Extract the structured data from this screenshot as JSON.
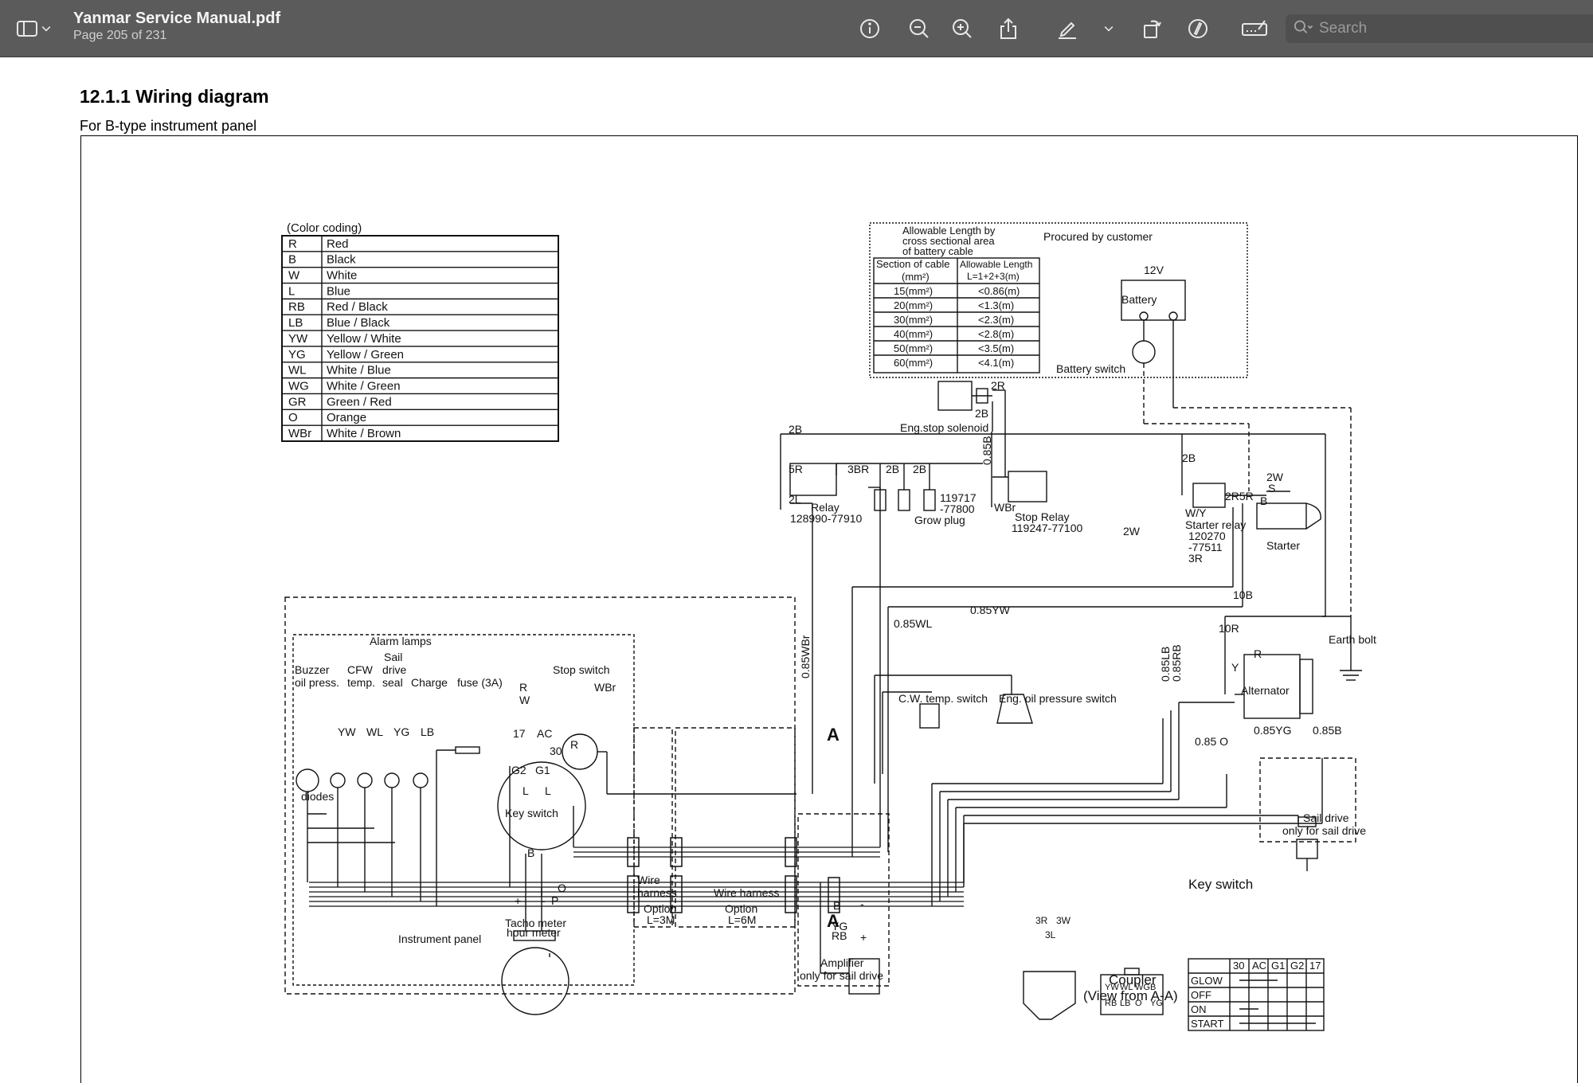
{
  "app": {
    "title": "Yanmar Service Manual.pdf",
    "subtitle": "Page 205 of 231",
    "search_placeholder": "Search",
    "icons": [
      "sidebar-icon",
      "chevron-down-icon",
      "info-icon",
      "zoom-out-icon",
      "zoom-in-icon",
      "share-icon",
      "highlight-pen-icon",
      "chevron-down-icon",
      "rotate-icon",
      "markup-icon",
      "form-fill-icon",
      "search-icon"
    ]
  },
  "page": {
    "section_title": "12.1.1 Wiring diagram",
    "section_subtitle": "For B-type instrument panel"
  },
  "diagram": {
    "color_coding": {
      "title": "(Color coding)",
      "rows": [
        [
          "R",
          "Red"
        ],
        [
          "B",
          "Black"
        ],
        [
          "W",
          "White"
        ],
        [
          "L",
          "Blue"
        ],
        [
          "RB",
          "Red / Black"
        ],
        [
          "LB",
          "Blue / Black"
        ],
        [
          "YW",
          "Yellow / White"
        ],
        [
          "YG",
          "Yellow / Green"
        ],
        [
          "WL",
          "White / Blue"
        ],
        [
          "WG",
          "White / Green"
        ],
        [
          "GR",
          "Green / Red"
        ],
        [
          "O",
          "Orange"
        ],
        [
          "WBr",
          "White / Brown"
        ]
      ]
    },
    "cable_table": {
      "title_lines": [
        "Allowable Length by",
        "cross sectional area",
        "of battery cable"
      ],
      "procured": "Procured by customer",
      "head1": [
        "Section of cable",
        "(mm²)"
      ],
      "head2": [
        "Allowable Length",
        "L=1+2+3(m)"
      ],
      "rows": [
        [
          "15(mm²)",
          "<0.86(m)"
        ],
        [
          "20(mm²)",
          "<1.3(m)"
        ],
        [
          "30(mm²)",
          "<2.3(m)"
        ],
        [
          "40(mm²)",
          "<2.8(m)"
        ],
        [
          "50(mm²)",
          "<3.5(m)"
        ],
        [
          "60(mm²)",
          "<4.1(m)"
        ]
      ]
    },
    "labels": {
      "v12": "12V",
      "battery": "Battery",
      "battery_switch": "Battery switch",
      "eng_stop": "Eng.stop solenoid",
      "w2R": "2R",
      "w2B": "2B",
      "w2B_top": "2B",
      "w5R": "5R",
      "w3BR": "3BR",
      "w2B_a": "2B",
      "w2B_b": "2B",
      "w2L": "2L",
      "relay": "Relay",
      "relay_pn": "128990-77910",
      "grow_pn1": "119717",
      "grow_pn2": "-77800",
      "grow": "Grow plug",
      "w085B": "0.85B",
      "wbr": "WBr",
      "stop_relay": "Stop Relay",
      "stop_relay_pn": "119247-77100",
      "w2W": "2W",
      "w2W_b": "2W",
      "w2B_c": "2B",
      "s": "S",
      "w2R5R": "2R5R",
      "b": "B",
      "wy": "W/Y",
      "starter_relay": "Starter relay",
      "sr_pn1": "120270",
      "sr_pn2": "-77511",
      "w3R": "3R",
      "starter": "Starter",
      "w10B": "10B",
      "w10R": "10R",
      "earth_bolt": "Earth bolt",
      "alternator": "Alternator",
      "y": "Y",
      "r": "R",
      "w085YW": "0.85YW",
      "w085WL": "0.85WL",
      "cw_temp": "C.W. temp. switch",
      "oil_press": "Eng. oil pressure switch",
      "w085LB": "0.85LB",
      "w085RB": "0.85RB",
      "w085O": "0.85 O",
      "w085YG": "0.85YG",
      "w085B2": "0.85B",
      "w085WBr": "0.85WBr",
      "a1": "A",
      "a2": "A",
      "sail_drive": "Sail drive",
      "sail_only": "only for sail drive",
      "alarm_lamps": "Alarm lamps",
      "buzzer": "Buzzer",
      "oil_press_s": "oil press.",
      "cfw": "CFW",
      "temp": "temp.",
      "sail": "Sail",
      "drive": "drive",
      "seal": "seal",
      "charge": "Charge",
      "fuse": "fuse (3A)",
      "stop_switch": "Stop switch",
      "wbr2": "WBr",
      "yw": "YW",
      "wl": "WL",
      "yg": "YG",
      "lb": "LB",
      "diodes": "diodes",
      "k17": "17",
      "kAC": "AC",
      "k30": "30",
      "kG2": "G2",
      "kG1": "G1",
      "kR": "R",
      "kW": "W",
      "kR2": "R",
      "kL1": "L",
      "kL2": "L",
      "key_switch": "Key switch",
      "tB": "B",
      "tO": "O",
      "tplus": "+",
      "tminus": "-",
      "tP": "P",
      "tacho1": "Tacho meter",
      "tacho2": "hour meter",
      "instrument_panel": "Instrument panel",
      "wh1": "Wire",
      "wh2": "harness",
      "opt1": "Option",
      "opt1b": "L=3M",
      "wh3": "Wire harness",
      "opt2": "Option",
      "opt2b": "L=6M",
      "amp_B": "B",
      "amp_YG": "YG",
      "amp_RB": "RB",
      "amp_m": "-",
      "amp_p": "+",
      "amplifier": "Amplifier",
      "amp_only": "only for sail drive",
      "c3R": "3R",
      "c3W": "3W",
      "c3L": "3L",
      "coup_cells": [
        "YW",
        "WL",
        "WG",
        "B",
        "RB",
        "LB",
        "O",
        "YG"
      ],
      "coupler": "Coupler",
      "coupler_view": "(View from A-A)",
      "key_title": "Key switch",
      "key_cols": [
        "30",
        "AC",
        "G1",
        "G2",
        "17"
      ],
      "key_rows": [
        "GLOW",
        "OFF",
        "ON",
        "START"
      ]
    }
  }
}
